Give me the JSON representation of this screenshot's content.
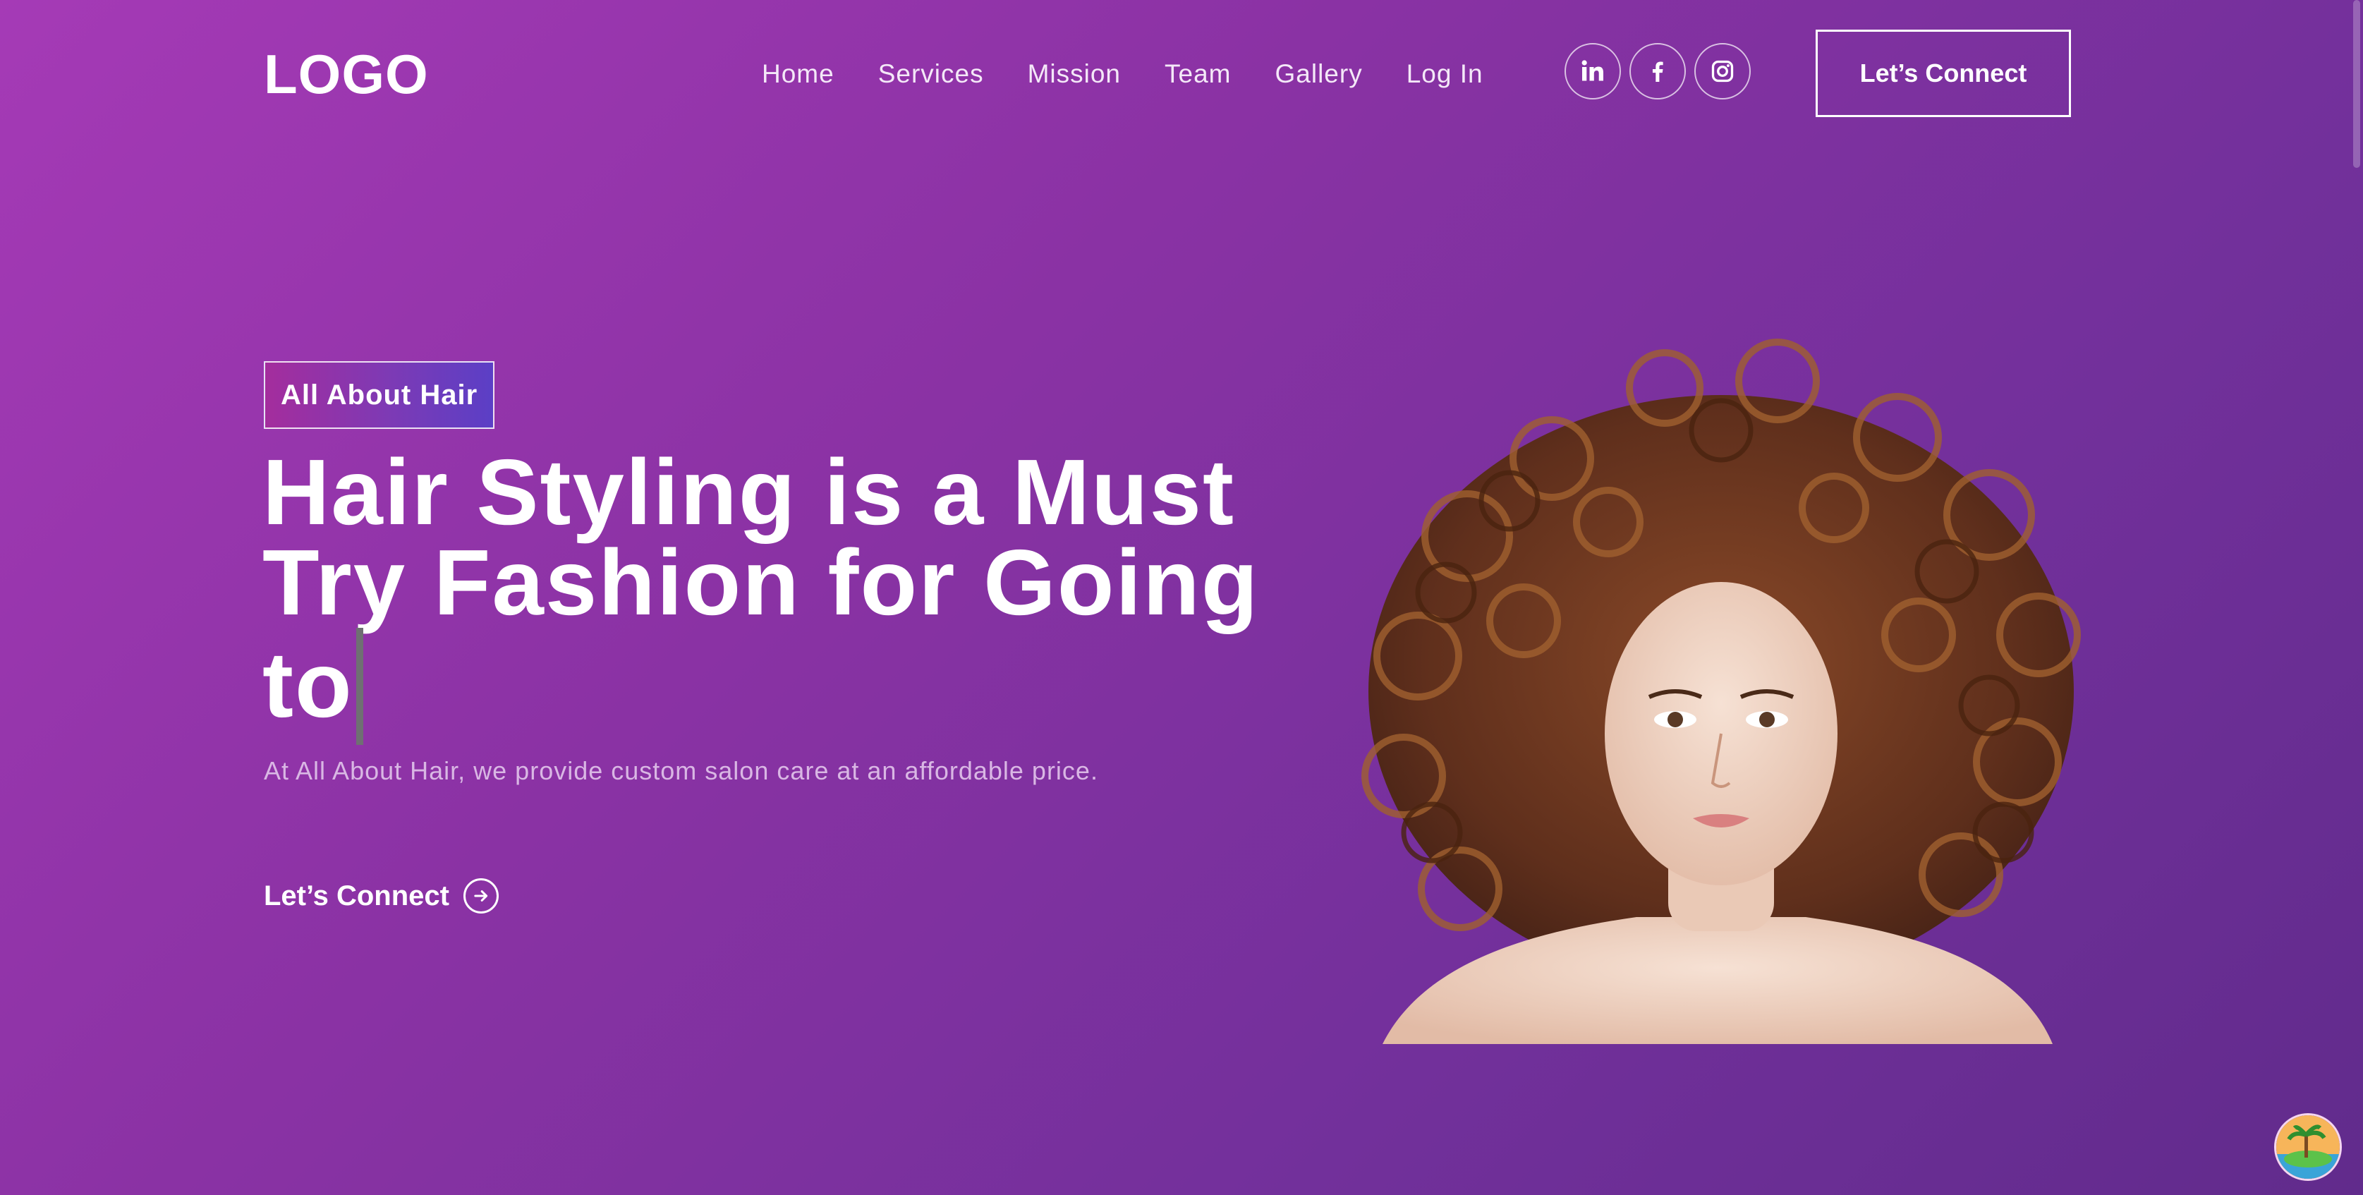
{
  "header": {
    "logo": "LOGO",
    "nav": [
      {
        "label": "Home"
      },
      {
        "label": "Services"
      },
      {
        "label": "Mission"
      },
      {
        "label": "Team"
      },
      {
        "label": "Gallery"
      },
      {
        "label": "Log In"
      }
    ],
    "socials": [
      {
        "icon": "linkedin-icon"
      },
      {
        "icon": "facebook-icon"
      },
      {
        "icon": "instagram-icon"
      }
    ],
    "connect_label": "Let’s Connect"
  },
  "hero": {
    "tag": "All About Hair",
    "headline": "Hair Styling is a Must Try Fashion for Going to",
    "subtext": "At All About Hair, we provide custom salon care at an affordable price.",
    "cta_label": "Let’s Connect",
    "cta_icon": "arrow-right-circle-icon",
    "image": "woman-curly-hair-portrait"
  },
  "colors": {
    "background_start": "#a53ab6",
    "background_end": "#612b8c",
    "text": "#ffffff",
    "subtext": "#d9b7e4",
    "tag_gradient_start": "#a42d9d",
    "tag_gradient_end": "#5b3fc6"
  }
}
